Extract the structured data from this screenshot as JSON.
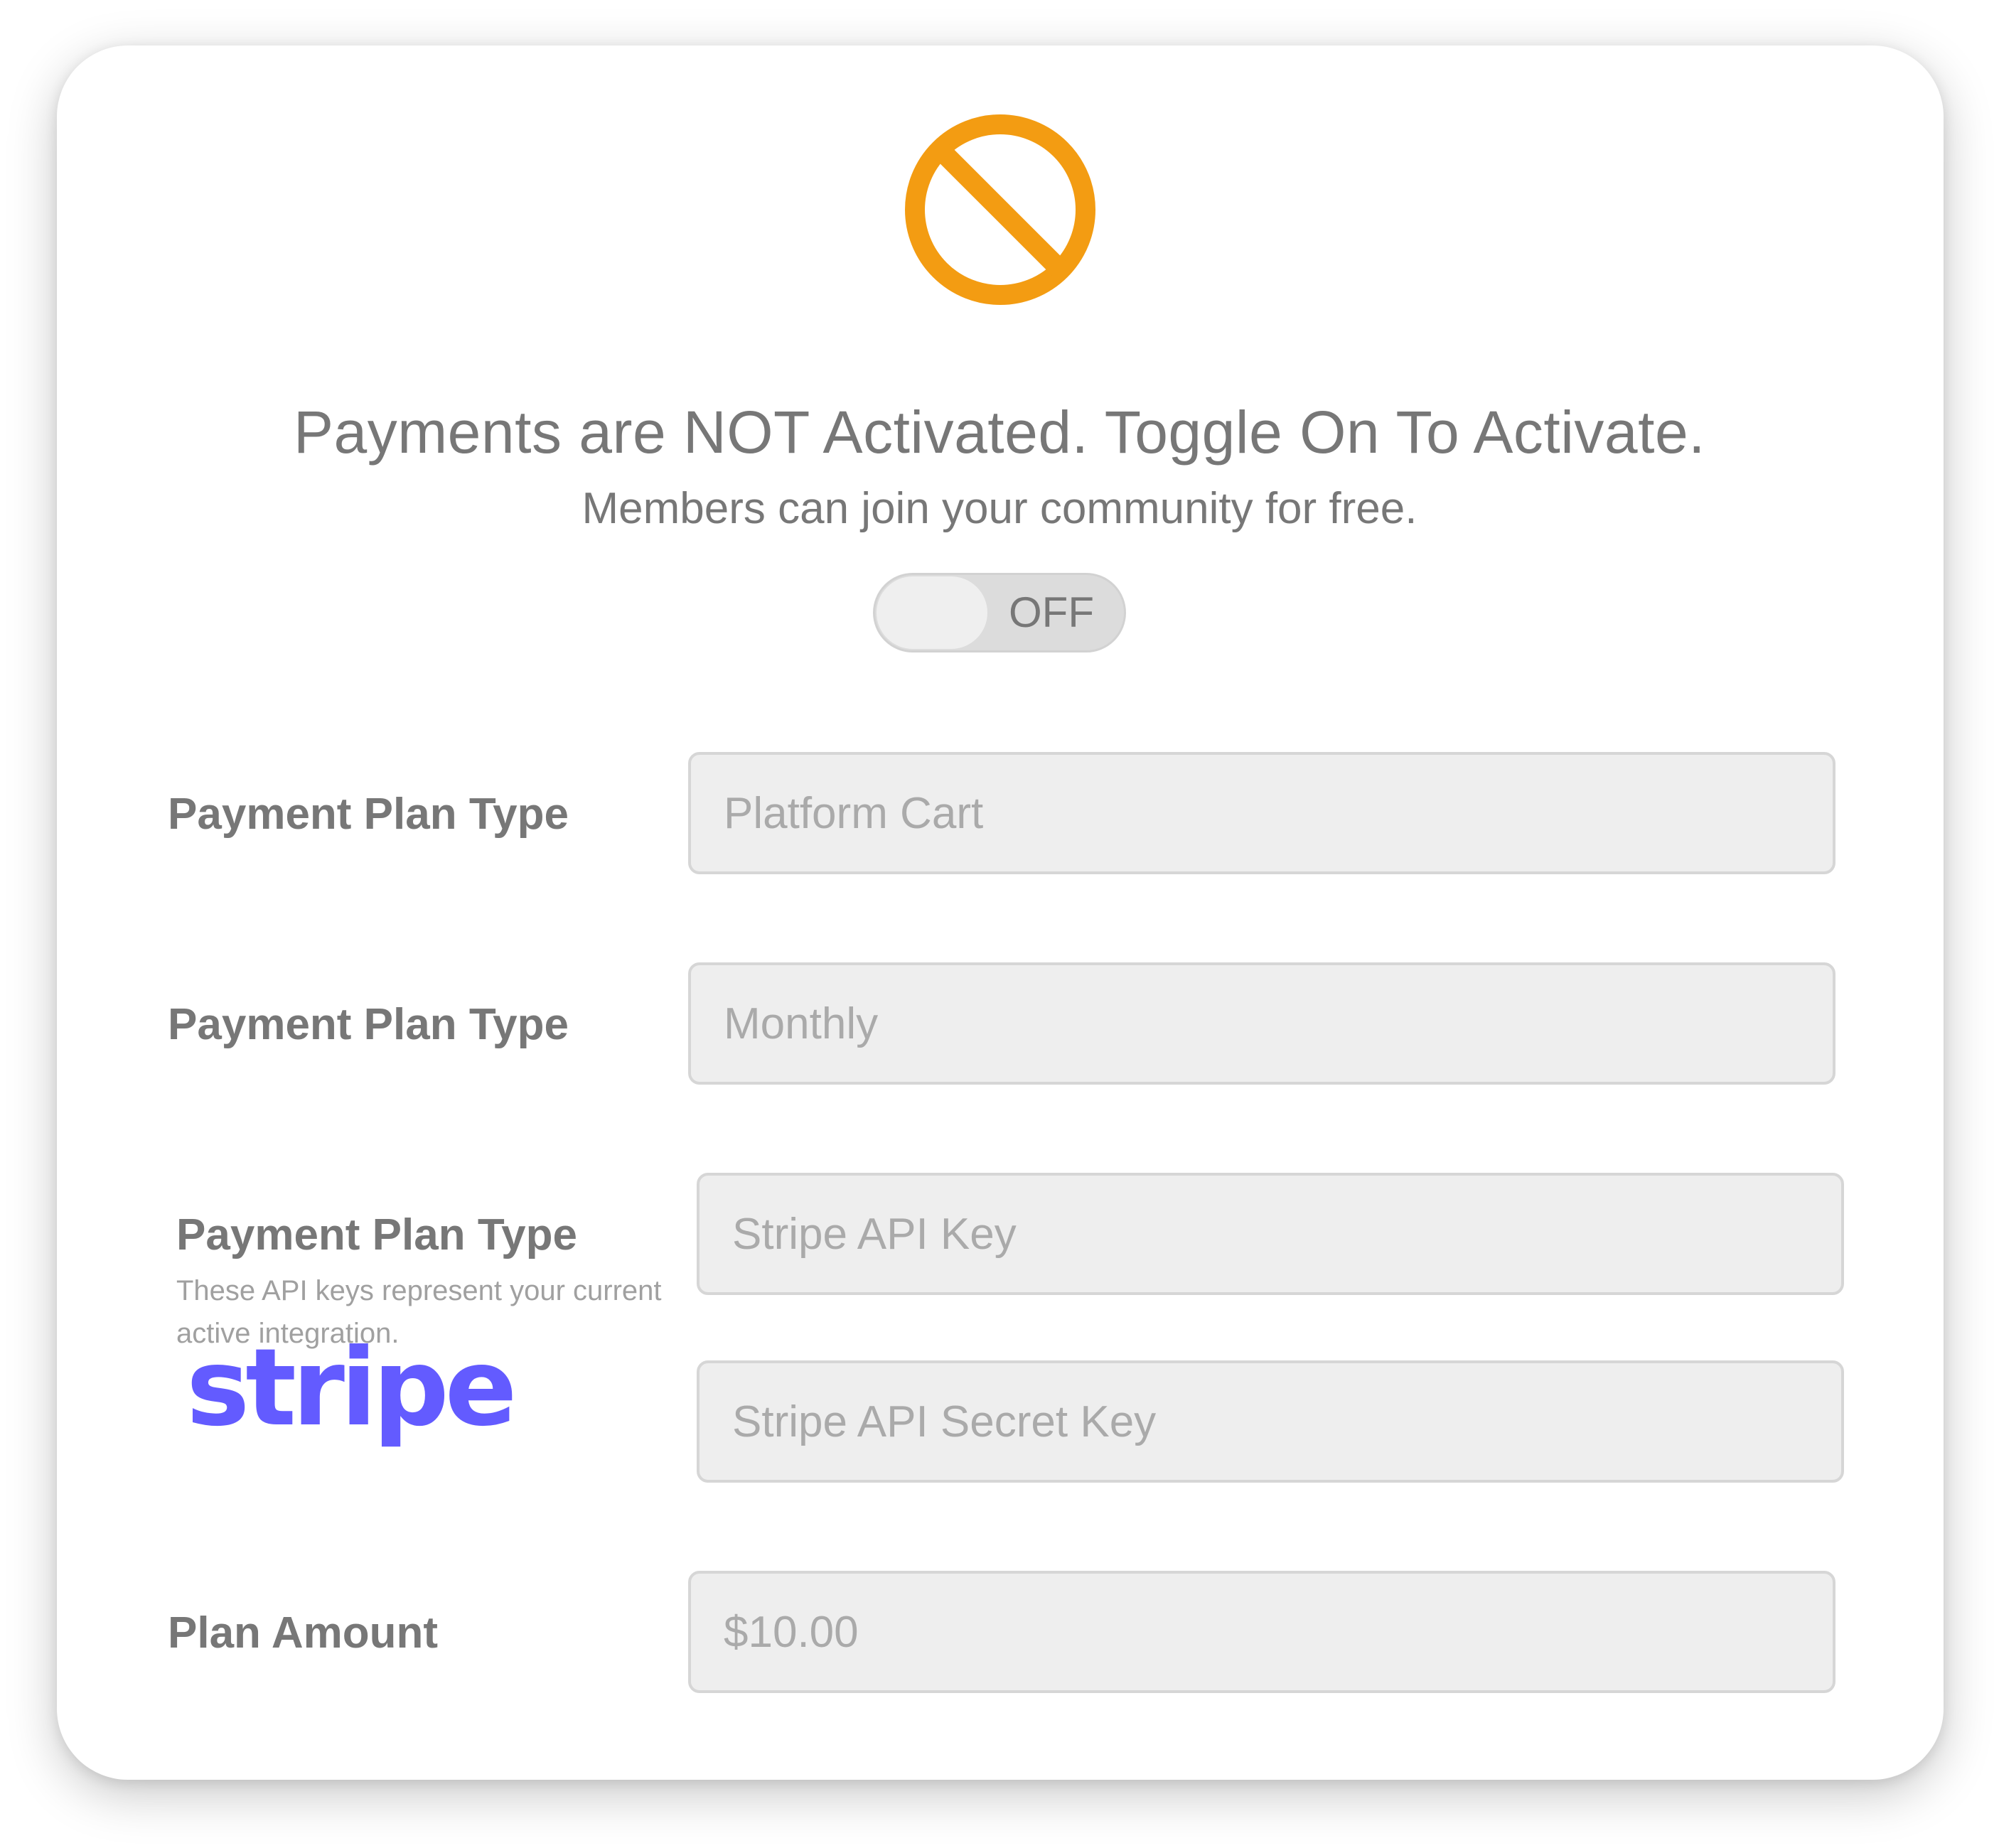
{
  "status": {
    "icon": "ban-icon",
    "icon_color": "#F39C12",
    "headline": "Payments are NOT Activated. Toggle On To Activate.",
    "subline": "Members can join your community for free."
  },
  "toggle": {
    "state_label": "OFF",
    "on": false
  },
  "form": {
    "row1": {
      "label": "Payment Plan Type",
      "placeholder": "Platform Cart"
    },
    "row2": {
      "label": "Payment Plan Type",
      "placeholder": "Monthly"
    },
    "row3": {
      "label": "Payment Plan Type",
      "helper": "These API keys represent your current active integration.",
      "logo_text": "stripe",
      "logo_color": "#635BFF",
      "api_key_placeholder": "Stripe API Key",
      "secret_key_placeholder": "Stripe API Secret Key"
    },
    "row4": {
      "label": "Plan Amount",
      "placeholder": "$10.00"
    }
  }
}
